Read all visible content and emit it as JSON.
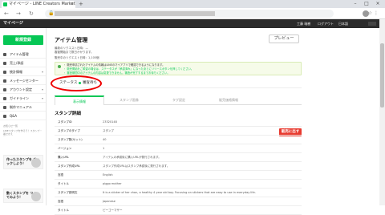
{
  "browser": {
    "tab_title": "マイページ - LINE Creators Market",
    "tab_close": "×",
    "new_tab": "+",
    "win_min": "–",
    "win_max": "□",
    "win_close": "×",
    "nav_back": "←",
    "nav_forward": "→",
    "nav_reload": "↻",
    "lock": "🔒",
    "ext_icons": "☆ ⋮"
  },
  "header": {
    "title": "マイページ",
    "links": [
      "工藤 瑞樹",
      "ログアウト",
      "日本語"
    ]
  },
  "sidebar": {
    "new_button": "新規登録",
    "items": [
      {
        "label": "アイテム管理",
        "icon": "grid-icon",
        "caret": ""
      },
      {
        "label": "売上/承認",
        "icon": "chart-icon",
        "caret": ""
      },
      {
        "label": "統計情報",
        "icon": "stats-icon",
        "caret": "▾"
      },
      {
        "label": "メッセージセンター",
        "icon": "mail-icon",
        "caret": ""
      },
      {
        "label": "アカウント設定",
        "icon": "user-icon",
        "caret": "▾"
      },
      {
        "label": "ガイドライン",
        "icon": "book-icon",
        "caret": "▾"
      },
      {
        "label": "制作マニュアル",
        "icon": "doc-icon",
        "caret": ""
      },
      {
        "label": "Q&A",
        "icon": "qa-icon",
        "caret": ""
      }
    ],
    "notices": [
      "お知らせ一覧",
      "LINEスタンプを作ろう！スタンプ・着せかえ",
      "…"
    ],
    "banners": [
      {
        "label": "作ったスタンプを チェックしよう！"
      },
      {
        "label": "動くスタンプを つくってみよう！"
      }
    ]
  },
  "main": {
    "page_title": "アイテム管理",
    "preview_button": "プレビュー",
    "meta": [
      "最新のリクエスト日時：—",
      "審査開始まで数日かかります。",
      "販売中のリクエスト日時：1,105個"
    ],
    "alert": {
      "lines": [
        {
          "text": "・ 販売申請されたアイテムの情報はLINEのマイアプリで確認できるようになります。",
          "color": "#333333"
        },
        {
          "text": "・ 販売開始をご希望の場合は、ステータスが「承認済み」になったあとにリリースボタンを押してください。",
          "color": "#06c755"
        },
        {
          "text": "・ 審査期間中のアイテムの内容は変更できません。審査が完了するまでお待ちください。",
          "color": "#06c755"
        }
      ]
    },
    "status": {
      "label": "ステータス",
      "value": "審査待ち"
    },
    "submit_button": "販売に出す",
    "tabs": [
      "表示情報",
      "スタンプ画像",
      "タグ設定",
      "販売価格情報"
    ],
    "active_tab": 0,
    "section_title": "スタンプ詳細",
    "details": [
      {
        "label": "スタンプID",
        "value": "23320148"
      },
      {
        "label": "スタンプのタイプ",
        "value": "スタンプ"
      },
      {
        "label": "スタンプ数(セット)",
        "value": "40"
      },
      {
        "label": "バージョン",
        "value": "1"
      },
      {
        "label": "購入URL",
        "value": "アイテムの承認後に購入URLが発行されます。"
      },
      {
        "label": "スタンプ作成URL",
        "value": "スタンプ作成URLはスタンプ承認後に発行されます。"
      },
      {
        "label": "言語",
        "value": "English"
      },
      {
        "label": "タイトル",
        "value": "piggo mother"
      },
      {
        "label": "スタンプ説明文",
        "value": "It is a sticker of her chan, a healthy 4 year old boy. Focusing on stickers that are easy to use in everyday life."
      },
      {
        "label": "言語",
        "value": "Japanese"
      },
      {
        "label": "タイトル",
        "value": "ピーゴーマザー"
      }
    ]
  }
}
